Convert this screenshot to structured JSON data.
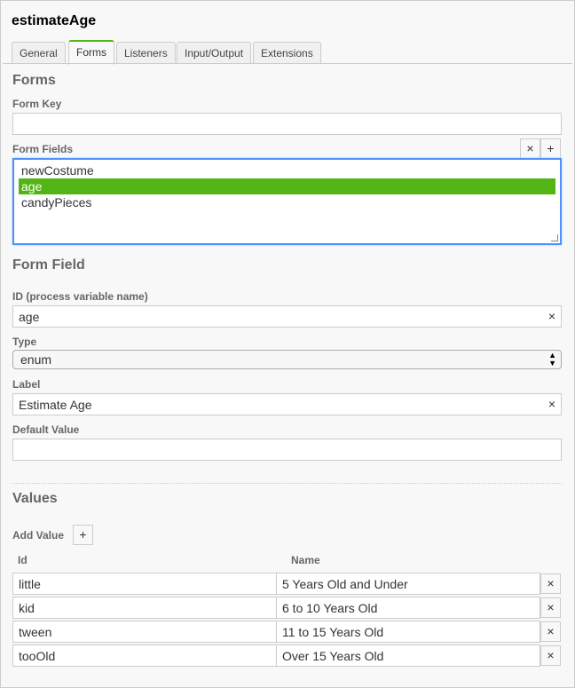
{
  "element_title": "estimateAge",
  "tabs": [
    "General",
    "Forms",
    "Listeners",
    "Input/Output",
    "Extensions"
  ],
  "forms": {
    "heading": "Forms",
    "form_key_label": "Form Key",
    "form_key_value": "",
    "form_fields_label": "Form Fields",
    "remove_glyph": "×",
    "add_glyph": "+",
    "fields": [
      "newCostume",
      "age",
      "candyPieces"
    ],
    "selected_field": "age"
  },
  "form_field": {
    "heading": "Form Field",
    "id_label": "ID (process variable name)",
    "id_value": "age",
    "type_label": "Type",
    "type_value": "enum",
    "label_label": "Label",
    "label_value": "Estimate Age",
    "default_label": "Default Value",
    "default_value": ""
  },
  "values": {
    "heading": "Values",
    "add_label": "Add Value",
    "col_id": "Id",
    "col_name": "Name",
    "rows": [
      {
        "id": "little",
        "name": "5 Years Old and Under"
      },
      {
        "id": "kid",
        "name": "6 to 10 Years Old"
      },
      {
        "id": "tween",
        "name": "11 to 15 Years Old"
      },
      {
        "id": "tooOld",
        "name": "Over 15 Years Old"
      }
    ]
  },
  "colors": {
    "accent": "#52b415",
    "focus": "#4d90fe"
  }
}
